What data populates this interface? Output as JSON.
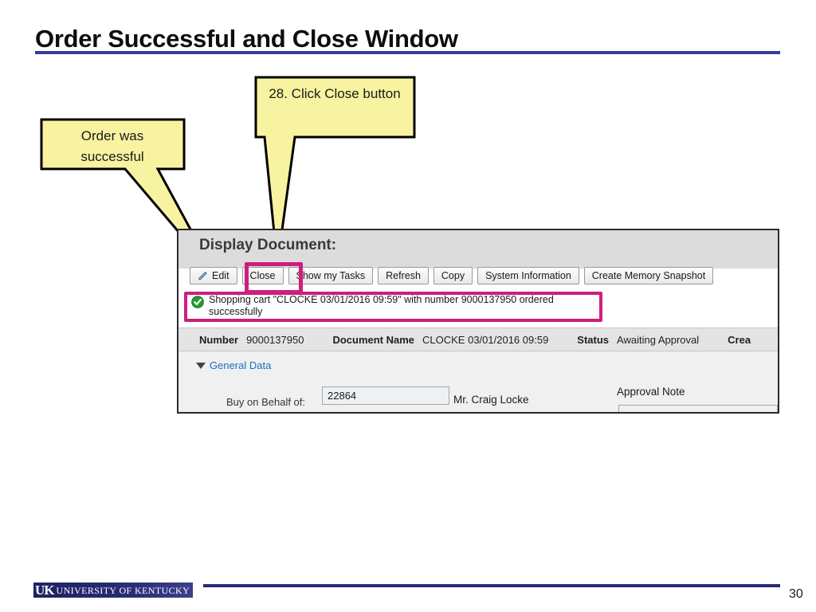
{
  "slide": {
    "title": "Order Successful and Close Window",
    "page_number": "30",
    "accent_color": "#3b3b9e"
  },
  "callouts": [
    {
      "id": "order-successful",
      "text": "Order was successful",
      "fill_color": "#f7f3a0"
    },
    {
      "id": "click-close",
      "text": "28. Click Close button",
      "fill_color": "#f7f3a0"
    }
  ],
  "highlight": {
    "color": "#cf1d7d"
  },
  "sap": {
    "document_heading": "Display Document:",
    "toolbar": [
      {
        "label": "Edit",
        "icon": "pencil-icon"
      },
      {
        "label": "Close",
        "icon": null
      },
      {
        "label": "Show my Tasks",
        "icon": null
      },
      {
        "label": "Refresh",
        "icon": null
      },
      {
        "label": "Copy",
        "icon": null
      },
      {
        "label": "System Information",
        "icon": null
      },
      {
        "label": "Create Memory Snapshot",
        "icon": null
      }
    ],
    "message": {
      "icon": "success-check-icon",
      "text": "Shopping cart \"CLOCKE 03/01/2016 09:59\" with number 9000137950 ordered successfully"
    },
    "detail": {
      "number_label": "Number",
      "number_value": "9000137950",
      "document_name_label": "Document Name",
      "document_name_value": "CLOCKE 03/01/2016 09:59",
      "status_label": "Status",
      "status_value": "Awaiting Approval",
      "created_label_clipped": "Crea"
    },
    "general_data": {
      "section_label": "General Data",
      "buy_on_behalf_label": "Buy on Behalf of:",
      "buy_on_behalf_value": "22864",
      "buy_on_behalf_name": "Mr. Craig Locke",
      "approval_note_label": "Approval Note",
      "approval_note_value": ""
    }
  },
  "footer": {
    "logo_mark": "UK",
    "logo_wordmark": "UNIVERSITY OF KENTUCKY"
  }
}
